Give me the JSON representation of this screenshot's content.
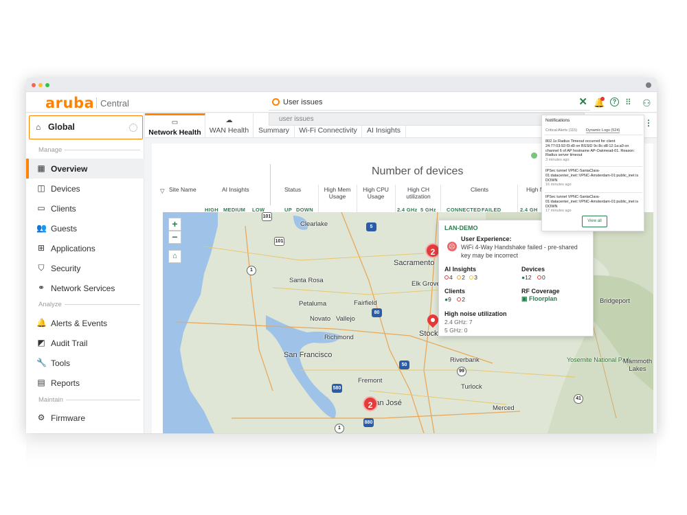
{
  "header": {
    "logo": "aruba",
    "product": "Central",
    "search_value": "User issues",
    "suggestion": "user issues"
  },
  "sidebar": {
    "scope": "Global",
    "sections": {
      "manage": "Manage",
      "analyze": "Analyze",
      "maintain": "Maintain"
    },
    "items": [
      {
        "label": "Overview",
        "icon": "grid-icon"
      },
      {
        "label": "Devices",
        "icon": "devices-icon"
      },
      {
        "label": "Clients",
        "icon": "clients-icon"
      },
      {
        "label": "Guests",
        "icon": "guests-icon"
      },
      {
        "label": "Applications",
        "icon": "applications-icon"
      },
      {
        "label": "Security",
        "icon": "shield-icon"
      },
      {
        "label": "Network Services",
        "icon": "network-icon"
      },
      {
        "label": "Alerts & Events",
        "icon": "bell-icon"
      },
      {
        "label": "Audit Trail",
        "icon": "audit-icon"
      },
      {
        "label": "Tools",
        "icon": "wrench-icon"
      },
      {
        "label": "Reports",
        "icon": "reports-icon"
      },
      {
        "label": "Firmware",
        "icon": "gear-icon"
      }
    ]
  },
  "tabs": [
    {
      "label": "Network Health"
    },
    {
      "label": "WAN Health"
    },
    {
      "label": "Summary"
    },
    {
      "label": "Wi-Fi Connectivity"
    },
    {
      "label": "AI Insights"
    }
  ],
  "table": {
    "title": "Number of devices",
    "columns": {
      "site_name": "Site Name",
      "ai_insights": "AI Insights",
      "status": "Status",
      "high_mem": "High Mem Usage",
      "high_cpu": "High CPU Usage",
      "high_ch": "High CH utilization",
      "clients": "Clients",
      "high_partial": "High N"
    },
    "subs": {
      "high": "HIGH",
      "medium": "MEDIUM",
      "low": "LOW",
      "up": "UP",
      "down": "DOWN",
      "ghz24": "2.4 GHz",
      "ghz5": "5 GHz",
      "connected": "CONNECTED",
      "failed": "FAILED",
      "ghz24b": "2.4 GH"
    }
  },
  "map": {
    "zoom_in": "+",
    "zoom_out": "−",
    "cities": [
      "Clearlake",
      "Sacramento",
      "Santa Rosa",
      "Elk Grove",
      "Petaluma",
      "Fairfield",
      "Novato",
      "Vallejo",
      "Richmond",
      "Stockton",
      "San Francisco",
      "Riverbank",
      "Fremont",
      "San José",
      "Turlock",
      "Merced",
      "Bridgeport",
      "Yosemite National Park",
      "Mammoth Lakes"
    ],
    "shields": [
      "101",
      "5",
      "101",
      "1",
      "80",
      "50",
      "1",
      "580",
      "880",
      "99",
      "41",
      "101"
    ],
    "clusters": [
      "2",
      "2"
    ]
  },
  "popup": {
    "site": "LAN-DEMO",
    "ux_heading": "User Experience:",
    "ux_text": "WiFi 4-Way Handshake failed - pre-shared key may be incorrect",
    "ai_heading": "AI Insights",
    "ai_values": [
      "4",
      "2",
      "3"
    ],
    "devices_heading": "Devices",
    "devices_up": "12",
    "devices_down": "0",
    "clients_heading": "Clients",
    "clients_ok": "9",
    "clients_failed": "2",
    "rf_heading": "RF Coverage",
    "rf_link": "Floorplan",
    "noise_heading": "High noise utilization",
    "noise_24": "2.4 GHz: 7",
    "noise_5": "5 GHz: 0"
  },
  "notifications": {
    "title": "Notifications",
    "tab_critical": "Critical Alerts (115)",
    "tab_logs": "Dynamic Logs (524)",
    "items": [
      {
        "text": "802.1x Radius Timeout occurred for client 24:77:03:92:f3:d0 on BSSID 9c:8c:d8:12:1a:a0 on channel 6 of AP hostname AP-Oakmead-01. Reason: Radius server timeout",
        "time": "3 minutes ago"
      },
      {
        "text": "IPSec tunnel VPNC-SantaClara-01:datacenter_inet::VPNC-Amsterdam-01:public_inet is DOWN",
        "time": "16 minutes ago"
      },
      {
        "text": "IPSec tunnel VPNC-SantaClara-01:datacenter_inet::VPNC-Amsterdam-01:public_inet is DOWN",
        "time": "17 minutes ago"
      }
    ],
    "view_all": "View all"
  },
  "colors": {
    "brand": "#ff8300",
    "accent_green": "#2a7d4f",
    "alert_red": "#e63b3b"
  }
}
